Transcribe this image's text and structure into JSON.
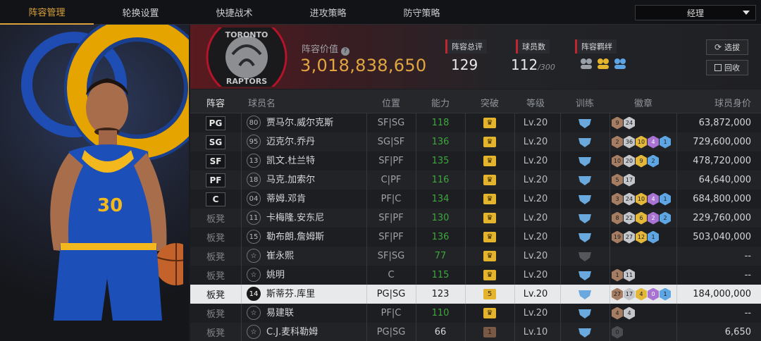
{
  "nav": {
    "tabs": [
      "阵容管理",
      "轮换设置",
      "快捷战术",
      "进攻策略",
      "防守策略"
    ],
    "active_tab": 0,
    "role_select": "经理"
  },
  "team": {
    "logo_text_top": "TORONTO",
    "logo_text_bottom": "RAPTORS",
    "value_label": "阵容价值",
    "value": "3,018,838,650",
    "rating_label": "阵容总评",
    "rating": "129",
    "player_count_label": "球员数",
    "player_count": "112",
    "player_count_max": "/300",
    "chemistry_label": "阵容羁绊",
    "scout_button": "选拔",
    "recycle_button": "回收",
    "accent": "#e2a640",
    "red": "#c0262d"
  },
  "table": {
    "headers": [
      "阵容",
      "球员名",
      "位置",
      "能力",
      "突破",
      "等级",
      "训练",
      "徽章",
      "球员身价"
    ],
    "rows": [
      {
        "slot": "PG",
        "starter": true,
        "number": "80",
        "name": "贾马尔.威尔克斯",
        "pos": "SF|SG",
        "ability": "118",
        "ability_green": true,
        "breakthrough": "",
        "level": "Lv.20",
        "badges": [
          [
            "br",
            "9"
          ],
          [
            "si",
            "24"
          ]
        ],
        "salary": "63,872,000"
      },
      {
        "slot": "SG",
        "starter": true,
        "number": "95",
        "name": "迈克尔.乔丹",
        "pos": "SG|SF",
        "ability": "136",
        "ability_green": true,
        "breakthrough": "",
        "level": "Lv.20",
        "badges": [
          [
            "br",
            "2"
          ],
          [
            "si",
            "36"
          ],
          [
            "go",
            "10"
          ],
          [
            "pu",
            "4"
          ],
          [
            "bl",
            "1"
          ]
        ],
        "salary": "729,600,000"
      },
      {
        "slot": "SF",
        "starter": true,
        "number": "13",
        "name": "凯文.杜兰特",
        "pos": "SF|PF",
        "ability": "135",
        "ability_green": true,
        "breakthrough": "",
        "level": "Lv.20",
        "badges": [
          [
            "br",
            "10"
          ],
          [
            "si",
            "20"
          ],
          [
            "go",
            "9"
          ],
          [
            "bl",
            "2"
          ]
        ],
        "salary": "478,720,000"
      },
      {
        "slot": "PF",
        "starter": true,
        "number": "18",
        "name": "马克.加索尔",
        "pos": "C|PF",
        "ability": "116",
        "ability_green": true,
        "breakthrough": "",
        "level": "Lv.20",
        "badges": [
          [
            "br",
            "5"
          ],
          [
            "si",
            "17"
          ]
        ],
        "salary": "64,640,000"
      },
      {
        "slot": "C",
        "starter": true,
        "number": "04",
        "name": "蒂姆.邓肯",
        "pos": "PF|C",
        "ability": "134",
        "ability_green": true,
        "breakthrough": "",
        "level": "Lv.20",
        "badges": [
          [
            "br",
            "3"
          ],
          [
            "si",
            "24"
          ],
          [
            "go",
            "10"
          ],
          [
            "pu",
            "4"
          ],
          [
            "bl",
            "1"
          ]
        ],
        "salary": "684,800,000"
      },
      {
        "slot": "板凳",
        "starter": false,
        "number": "11",
        "name": "卡梅隆.安东尼",
        "pos": "SF|PF",
        "ability": "130",
        "ability_green": true,
        "breakthrough": "",
        "level": "Lv.20",
        "badges": [
          [
            "br",
            "8"
          ],
          [
            "si",
            "22"
          ],
          [
            "go",
            "6"
          ],
          [
            "pu",
            "2"
          ],
          [
            "bl",
            "2"
          ]
        ],
        "salary": "229,760,000"
      },
      {
        "slot": "板凳",
        "starter": false,
        "number": "15",
        "name": "勒布朗.詹姆斯",
        "pos": "SF|PF",
        "ability": "136",
        "ability_green": true,
        "breakthrough": "",
        "level": "Lv.20",
        "badges": [
          [
            "br",
            "19"
          ],
          [
            "si",
            "27"
          ],
          [
            "go",
            "12"
          ],
          [
            "bl",
            "1"
          ]
        ],
        "salary": "503,040,000"
      },
      {
        "slot": "板凳",
        "starter": false,
        "number": "",
        "name": "崔永熙",
        "pos": "SF|SG",
        "ability": "77",
        "ability_green": true,
        "breakthrough": "",
        "level": "Lv.20",
        "badges": [],
        "salary": "--"
      },
      {
        "slot": "板凳",
        "starter": false,
        "number": "",
        "name": "姚明",
        "pos": "C",
        "ability": "115",
        "ability_green": true,
        "breakthrough": "",
        "level": "Lv.20",
        "badges": [
          [
            "br",
            "1"
          ],
          [
            "si",
            "11"
          ]
        ],
        "salary": "--"
      },
      {
        "slot": "板凳",
        "starter": false,
        "number": "14",
        "name": "斯蒂芬.库里",
        "pos": "PG|SG",
        "ability": "123",
        "ability_green": false,
        "breakthrough": "5",
        "level": "Lv.20",
        "badges": [
          [
            "br",
            "27"
          ],
          [
            "si",
            "17"
          ],
          [
            "go",
            "4"
          ],
          [
            "pu",
            "0"
          ],
          [
            "bl",
            "1"
          ]
        ],
        "salary": "184,000,000",
        "selected": true
      },
      {
        "slot": "板凳",
        "starter": false,
        "number": "",
        "name": "易建联",
        "pos": "PF|C",
        "ability": "110",
        "ability_green": true,
        "breakthrough": "",
        "level": "Lv.20",
        "badges": [
          [
            "br",
            "4"
          ],
          [
            "si",
            "4"
          ]
        ],
        "salary": "--"
      },
      {
        "slot": "板凳",
        "starter": false,
        "number": "",
        "name": "C.J.麦科勒姆",
        "pos": "PG|SG",
        "ability": "66",
        "ability_green": false,
        "breakthrough": "1",
        "level": "Lv.10",
        "badges": [
          [
            "dk",
            "0"
          ]
        ],
        "salary": "6,650"
      }
    ]
  }
}
